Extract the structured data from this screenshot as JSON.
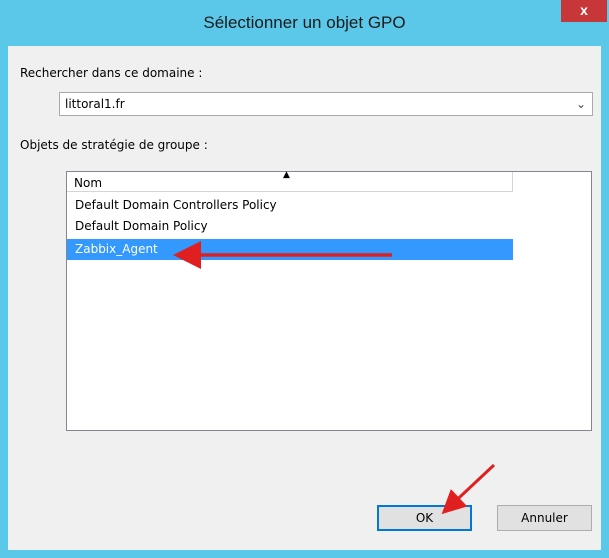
{
  "window": {
    "title": "Sélectionner un objet GPO",
    "close_glyph": "x"
  },
  "domain_section": {
    "label": "Rechercher dans ce domaine :",
    "selected_value": "littoral1.fr",
    "arrow_glyph": "⌄"
  },
  "gpo_section": {
    "label": "Objets de stratégie de groupe :",
    "column_header": "Nom",
    "sort_indicator": "▲",
    "items": [
      {
        "label": "Default Domain Controllers Policy",
        "selected": false
      },
      {
        "label": "Default Domain Policy",
        "selected": false
      },
      {
        "label": "Zabbix_Agent",
        "selected": true
      }
    ]
  },
  "buttons": {
    "ok_label": "OK",
    "cancel_label": "Annuler"
  },
  "colors": {
    "titlebar": "#5bc8ea",
    "close_button": "#c7373a",
    "selection": "#3399ff",
    "annotation_arrow": "#e02020"
  }
}
